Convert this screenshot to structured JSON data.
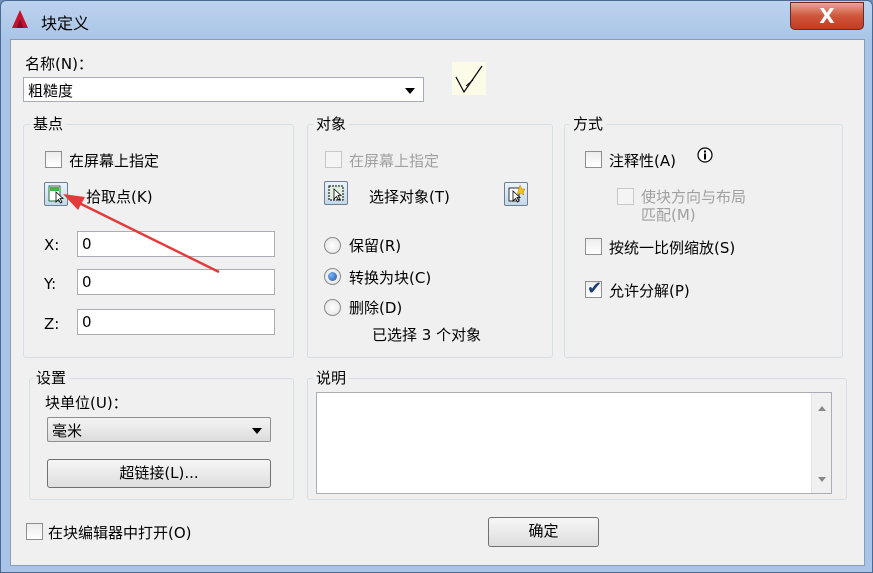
{
  "window": {
    "title": "块定义",
    "close_label": "X"
  },
  "name": {
    "label": "名称(N)：",
    "value": "粗糙度"
  },
  "basepoint": {
    "title": "基点",
    "on_screen": "在屏幕上指定",
    "pick_point": "拾取点(K)",
    "x_label": "X:",
    "x_value": "0",
    "y_label": "Y:",
    "y_value": "0",
    "z_label": "Z:",
    "z_value": "0"
  },
  "objects": {
    "title": "对象",
    "on_screen": "在屏幕上指定",
    "select_objects": "选择对象(T)",
    "retain": "保留(R)",
    "convert": "转换为块(C)",
    "delete": "删除(D)",
    "status": "已选择 3 个对象"
  },
  "behavior": {
    "title": "方式",
    "annotative": "注释性(A)",
    "match_orientation_line1": "使块方向与布局",
    "match_orientation_line2": "匹配(M)",
    "scale_uniformly": "按统一比例缩放(S)",
    "allow_explode": "允许分解(P)"
  },
  "settings": {
    "title": "设置",
    "unit_label": "块单位(U)：",
    "unit_value": "毫米",
    "hyperlink": "超链接(L)..."
  },
  "description": {
    "title": "说明"
  },
  "footer": {
    "open_in_editor": "在块编辑器中打开(O)",
    "ok": "确定"
  },
  "colors": {
    "accent_arrow": "#e53a3a",
    "title_bar": "#a9c4e6",
    "close_button": "#c9452b"
  }
}
